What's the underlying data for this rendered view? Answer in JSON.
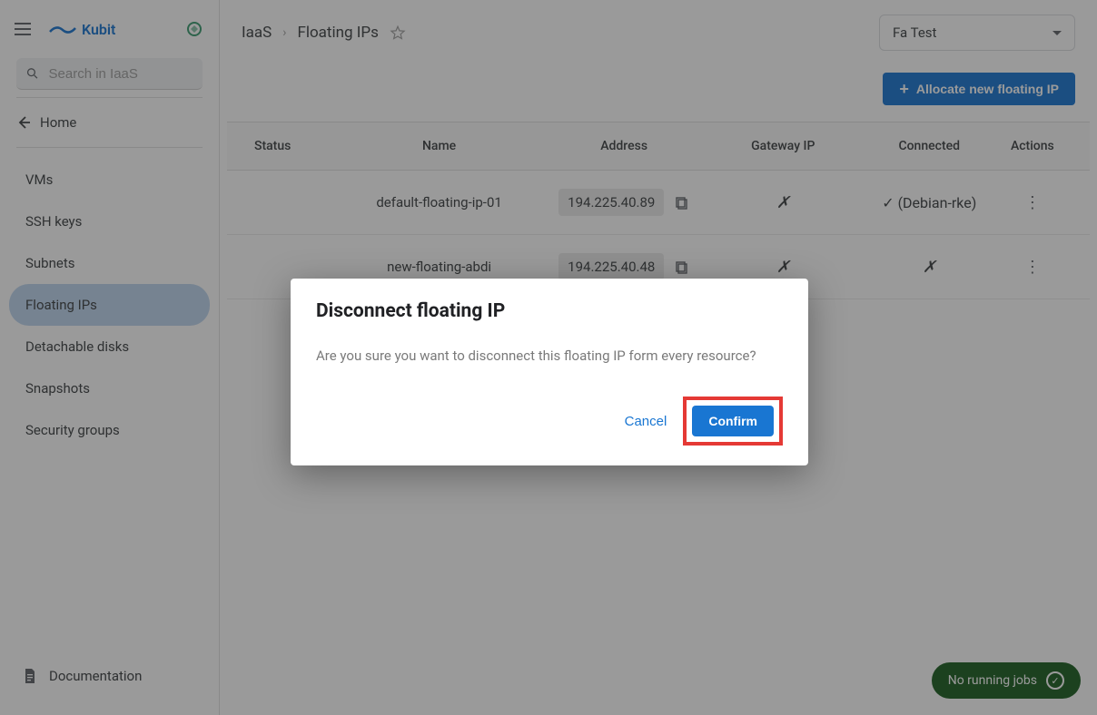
{
  "brand": "Kubit",
  "search": {
    "placeholder": "Search in IaaS"
  },
  "home": "Home",
  "nav": {
    "vms": "VMs",
    "ssh": "SSH keys",
    "subnets": "Subnets",
    "fips": "Floating IPs",
    "disks": "Detachable disks",
    "snapshots": "Snapshots",
    "secgroups": "Security groups"
  },
  "documentation": "Documentation",
  "breadcrumb": {
    "root": "IaaS",
    "page": "Floating IPs"
  },
  "project": "Fa Test",
  "allocate": "Allocate new floating IP",
  "table": {
    "headers": {
      "status": "Status",
      "name": "Name",
      "address": "Address",
      "gateway": "Gateway IP",
      "connected": "Connected",
      "actions": "Actions"
    },
    "rows": [
      {
        "name": "default-floating-ip-01",
        "address": "194.225.40.89",
        "gateway": "✗",
        "connected": "✓ (Debian-rke)"
      },
      {
        "name": "new-floating-abdi",
        "address": "194.225.40.48",
        "gateway": "✗",
        "connected": "✗"
      }
    ]
  },
  "jobs": "No running jobs",
  "modal": {
    "title": "Disconnect floating IP",
    "body": "Are you sure you want to disconnect this floating IP form every resource?",
    "cancel": "Cancel",
    "confirm": "Confirm"
  }
}
